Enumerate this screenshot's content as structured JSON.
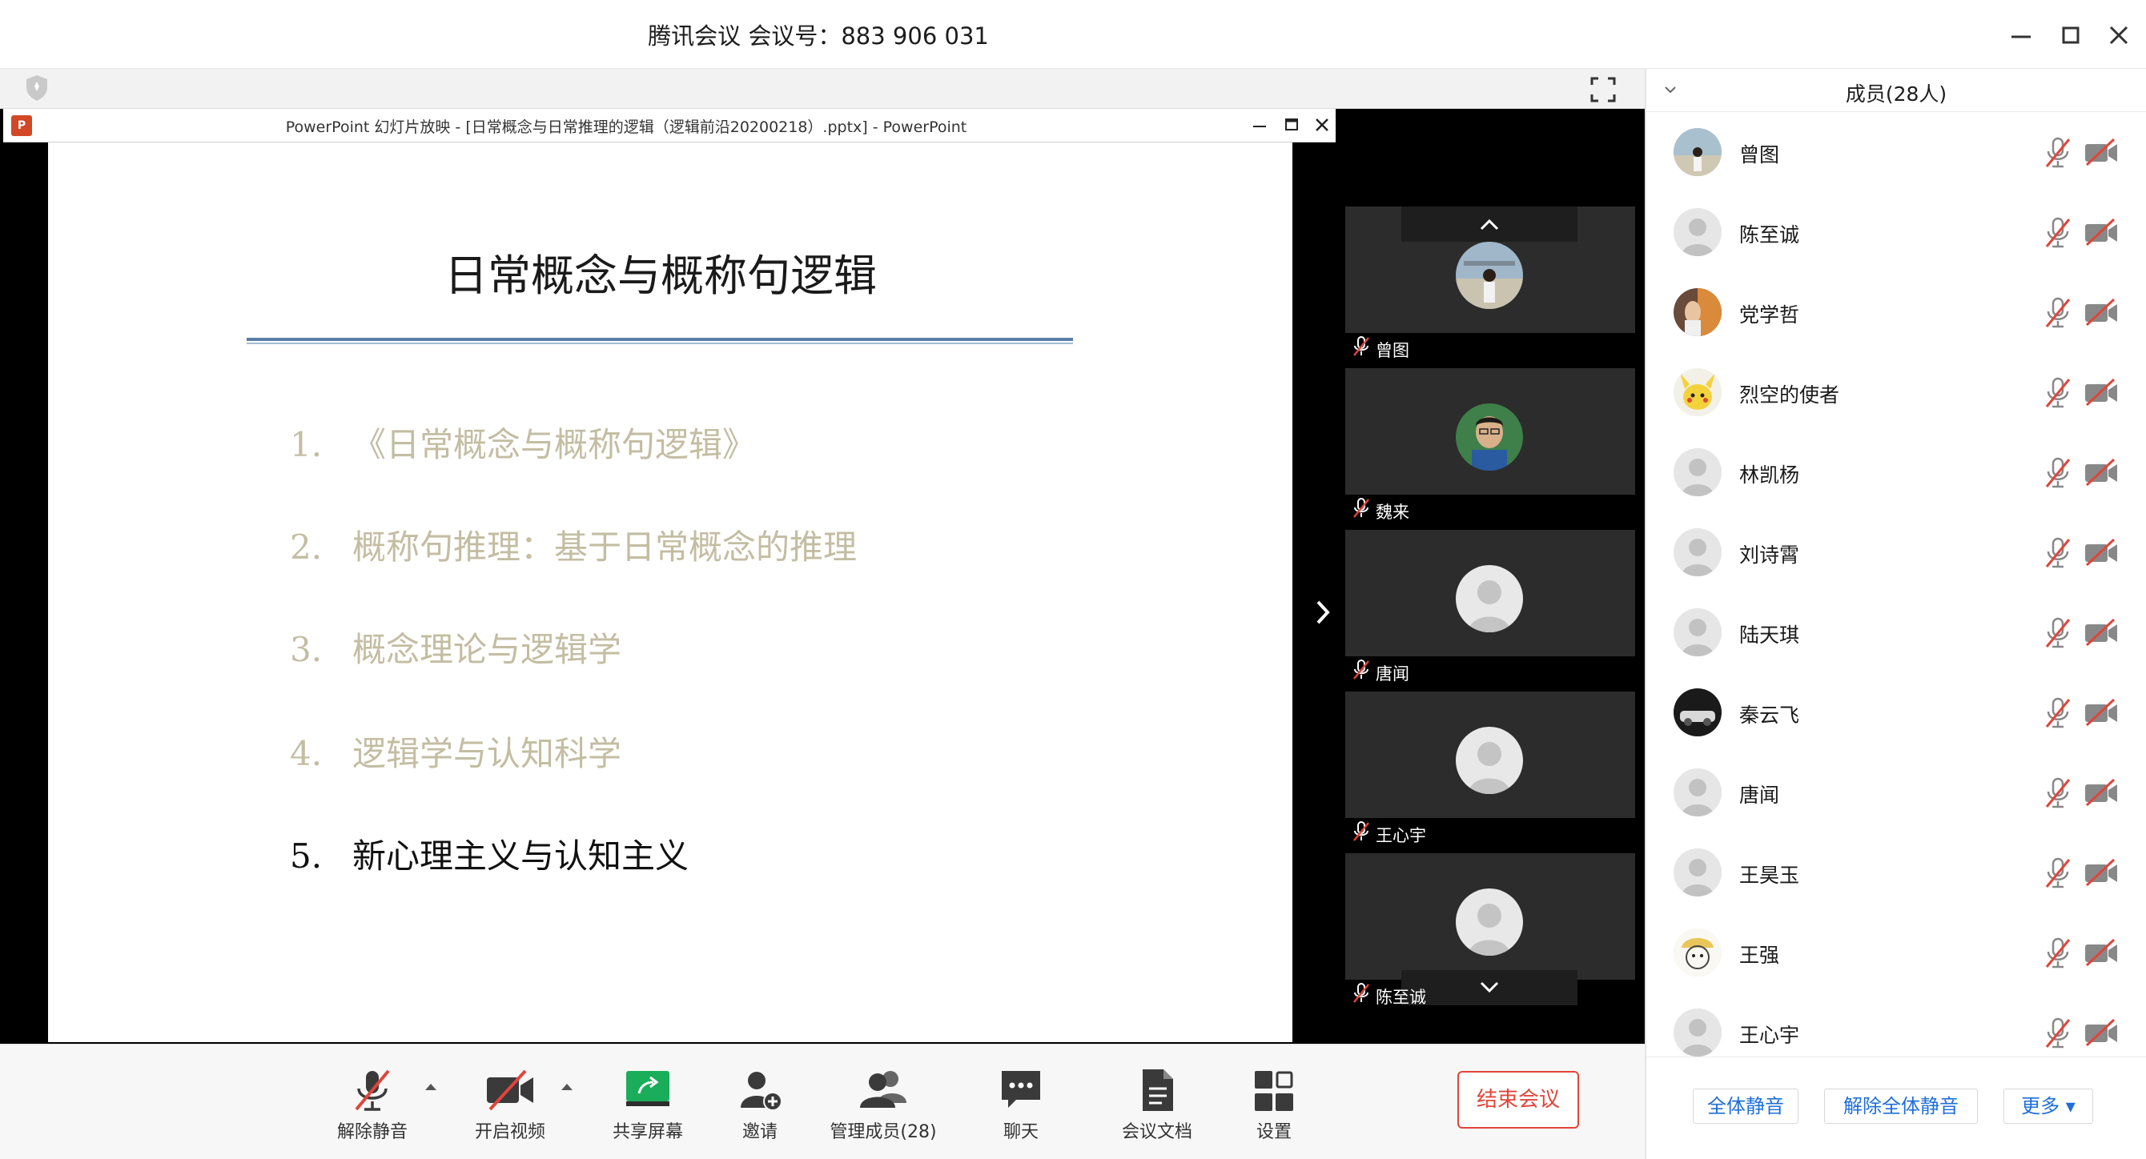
{
  "app": {
    "title": "腾讯会议 会议号：883 906 031",
    "window_buttons": [
      "minimize-icon",
      "maximize-icon",
      "close-icon"
    ]
  },
  "powerpoint": {
    "window_title": "PowerPoint 幻灯片放映 - [日常概念与日常推理的逻辑（逻辑前沿20200218）.pptx] - PowerPoint",
    "icon_text": "P"
  },
  "slide": {
    "title": "日常概念与概称句逻辑",
    "items": [
      {
        "num": "1.",
        "text": "《日常概念与概称句逻辑》",
        "active": false
      },
      {
        "num": "2.",
        "text": "概称句推理：基于日常概念的推理",
        "active": false
      },
      {
        "num": "3.",
        "text": "概念理论与逻辑学",
        "active": false
      },
      {
        "num": "4.",
        "text": "逻辑学与认知科学",
        "active": false
      },
      {
        "num": "5.",
        "text": "新心理主义与认知主义",
        "active": true
      }
    ]
  },
  "video_tiles": [
    {
      "name": "曾图",
      "avatar": "photo-woman"
    },
    {
      "name": "魏来",
      "avatar": "photo-man"
    },
    {
      "name": "唐闻",
      "avatar": "default"
    },
    {
      "name": "王心宇",
      "avatar": "default"
    },
    {
      "name": "陈至诚",
      "avatar": "default"
    }
  ],
  "toolbar": {
    "unmute": "解除静音",
    "start_video": "开启视频",
    "share_screen": "共享屏幕",
    "invite": "邀请",
    "manage_members": "管理成员(28)",
    "chat": "聊天",
    "meeting_docs": "会议文档",
    "settings": "设置",
    "end_meeting": "结束会议"
  },
  "panel": {
    "title": "成员(28人)",
    "members": [
      {
        "name": "曾图",
        "avatar": "photo-woman"
      },
      {
        "name": "陈至诚",
        "avatar": "default"
      },
      {
        "name": "党学哲",
        "avatar": "photo-orange"
      },
      {
        "name": "烈空的使者",
        "avatar": "pikachu"
      },
      {
        "name": "林凯杨",
        "avatar": "default"
      },
      {
        "name": "刘诗霄",
        "avatar": "default"
      },
      {
        "name": "陆天琪",
        "avatar": "default"
      },
      {
        "name": "秦云飞",
        "avatar": "photo-dark"
      },
      {
        "name": "唐闻",
        "avatar": "default"
      },
      {
        "name": "王昊玉",
        "avatar": "default"
      },
      {
        "name": "王强",
        "avatar": "cartoon"
      },
      {
        "name": "王心宇",
        "avatar": "default"
      }
    ],
    "mute_all": "全体静音",
    "unmute_all": "解除全体静音",
    "more": "更多 ▾"
  },
  "colors": {
    "end_meeting": "#e0453a",
    "link_blue": "#1e6fd9",
    "share_green": "#1aad5a",
    "muted_red": "#e0453a",
    "slide_rule": "#5a7ea8"
  }
}
